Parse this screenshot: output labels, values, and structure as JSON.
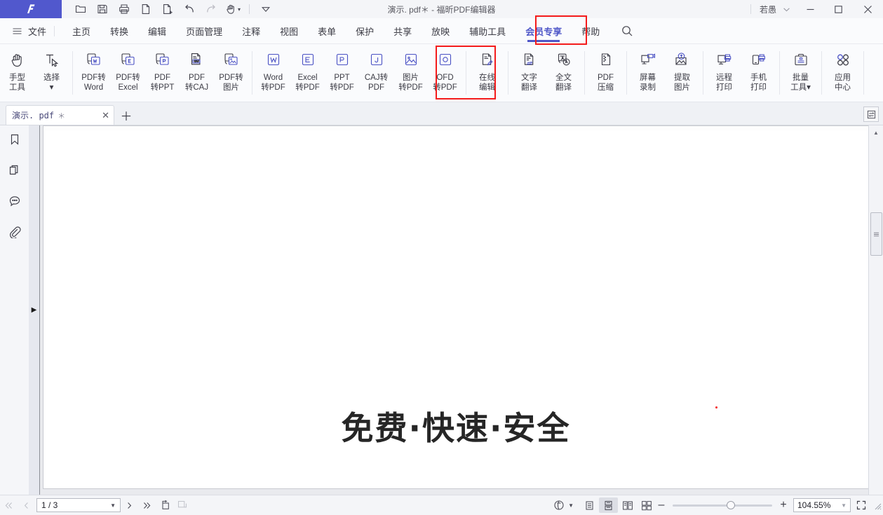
{
  "app": {
    "brand_color": "#5158cd",
    "logo_letter": "F",
    "window_title": "演示. pdf＊ - 福昕PDF编辑器",
    "file_name": "演示. pdf",
    "modified_mark": "＊",
    "title_suffix": "- 福昕PDF编辑器",
    "user_name": "若愚"
  },
  "quick_access": [
    {
      "name": "open-file",
      "icon": "folder-icon"
    },
    {
      "name": "save",
      "icon": "save-icon"
    },
    {
      "name": "print",
      "icon": "printer-icon"
    },
    {
      "name": "new-from-file",
      "icon": "document-icon"
    },
    {
      "name": "new-page",
      "icon": "document-add-icon"
    },
    {
      "name": "undo",
      "icon": "undo-icon"
    },
    {
      "name": "redo",
      "icon": "redo-icon"
    },
    {
      "name": "hand-tool",
      "icon": "hand-icon"
    },
    {
      "name": "customize",
      "icon": "chevron-down-icon"
    }
  ],
  "window_controls": {
    "minimize": "—",
    "maximize": "☐",
    "close": "✕"
  },
  "menubar": {
    "file_label": "文件",
    "items": [
      {
        "label": "主页",
        "active": false
      },
      {
        "label": "转换",
        "active": false
      },
      {
        "label": "编辑",
        "active": false
      },
      {
        "label": "页面管理",
        "active": false
      },
      {
        "label": "注释",
        "active": false
      },
      {
        "label": "视图",
        "active": false
      },
      {
        "label": "表单",
        "active": false
      },
      {
        "label": "保护",
        "active": false
      },
      {
        "label": "共享",
        "active": false
      },
      {
        "label": "放映",
        "active": false
      },
      {
        "label": "辅助工具",
        "active": false
      },
      {
        "label": "会员专享",
        "active": true
      },
      {
        "label": "帮助",
        "active": false
      }
    ],
    "highlight_color": "#f41b1b",
    "active_color": "#4f57c8"
  },
  "ribbon": {
    "groups": [
      {
        "name": "tools",
        "items": [
          {
            "name": "hand-tool",
            "icon": "hand-icon",
            "line1": "手型",
            "line2": "工具",
            "caret": false
          },
          {
            "name": "select-tool",
            "icon": "select-text-icon",
            "line1": "选择",
            "line2": "▾",
            "caret": true
          }
        ]
      },
      {
        "name": "pdf-to-x",
        "items": [
          {
            "name": "pdf-to-word",
            "icon": "pdf-to-word-icon",
            "line1": "PDF转",
            "line2": "Word"
          },
          {
            "name": "pdf-to-excel",
            "icon": "pdf-to-excel-icon",
            "line1": "PDF转",
            "line2": "Excel"
          },
          {
            "name": "pdf-to-ppt",
            "icon": "pdf-to-ppt-icon",
            "line1": "PDF",
            "line2": "转PPT"
          },
          {
            "name": "pdf-to-caj",
            "icon": "pdf-to-caj-icon",
            "line1": "PDF",
            "line2": "转CAJ"
          },
          {
            "name": "pdf-to-image",
            "icon": "pdf-to-image-icon",
            "line1": "PDF转",
            "line2": "图片"
          }
        ]
      },
      {
        "name": "x-to-pdf",
        "items": [
          {
            "name": "word-to-pdf",
            "icon": "word-icon",
            "line1": "Word",
            "line2": "转PDF"
          },
          {
            "name": "excel-to-pdf",
            "icon": "excel-icon",
            "line1": "Excel",
            "line2": "转PDF"
          },
          {
            "name": "ppt-to-pdf",
            "icon": "ppt-icon",
            "line1": "PPT",
            "line2": "转PDF"
          },
          {
            "name": "caj-to-pdf",
            "icon": "caj-icon",
            "line1": "CAJ转",
            "line2": "PDF"
          },
          {
            "name": "image-to-pdf",
            "icon": "image-icon",
            "line1": "图片",
            "line2": "转PDF"
          },
          {
            "name": "ofd-to-pdf",
            "icon": "ofd-icon",
            "line1": "OFD",
            "line2": "转PDF"
          }
        ]
      },
      {
        "name": "online-edit",
        "items": [
          {
            "name": "online-edit",
            "icon": "online-edit-icon",
            "line1": "在线",
            "line2": "编辑"
          }
        ]
      },
      {
        "name": "translate",
        "highlighted": true,
        "items": [
          {
            "name": "text-translate",
            "icon": "text-translate-icon",
            "line1": "文字",
            "line2": "翻译"
          },
          {
            "name": "full-translate",
            "icon": "full-translate-icon",
            "line1": "全文",
            "line2": "翻译"
          }
        ]
      },
      {
        "name": "compress",
        "items": [
          {
            "name": "pdf-compress",
            "icon": "compress-icon",
            "line1": "PDF",
            "line2": "压缩"
          }
        ]
      },
      {
        "name": "capture",
        "items": [
          {
            "name": "screen-record",
            "icon": "screen-record-icon",
            "line1": "屏幕",
            "line2": "录制"
          },
          {
            "name": "extract-image",
            "icon": "extract-image-icon",
            "line1": "提取",
            "line2": "图片"
          }
        ]
      },
      {
        "name": "print-group",
        "items": [
          {
            "name": "remote-print",
            "icon": "remote-print-icon",
            "line1": "远程",
            "line2": "打印"
          },
          {
            "name": "mobile-print",
            "icon": "mobile-print-icon",
            "line1": "手机",
            "line2": "打印"
          }
        ]
      },
      {
        "name": "batch",
        "items": [
          {
            "name": "batch-tools",
            "icon": "briefcase-icon",
            "line1": "批量",
            "line2": "工具▾",
            "caret": true
          }
        ]
      },
      {
        "name": "app-center",
        "items": [
          {
            "name": "app-center",
            "icon": "grid-apps-icon",
            "line1": "应用",
            "line2": "中心"
          }
        ]
      }
    ],
    "highlight_color": "#f41b1b"
  },
  "doc_tabs": {
    "tabs": [
      {
        "name": "演示. pdf",
        "modified": "＊",
        "close": "✕",
        "active": true
      }
    ],
    "add_label": "＋"
  },
  "left_rail": [
    {
      "name": "bookmarks-panel",
      "icon": "bookmark-icon"
    },
    {
      "name": "thumbnails-panel",
      "icon": "pages-icon"
    },
    {
      "name": "comments-panel",
      "icon": "comment-icon"
    },
    {
      "name": "attachments-panel",
      "icon": "paperclip-icon"
    }
  ],
  "document": {
    "heading": "免费·快速·安全"
  },
  "status_bar": {
    "first_page": "«",
    "prev_page": "‹",
    "page_value": "1 / 3",
    "next_page": "›",
    "last_page": "»",
    "rotate_left": "rotate-left-icon",
    "rotate_right": "rotate-right-icon",
    "read_mode": "read-mode-icon",
    "view_modes": [
      {
        "name": "single-page-view",
        "icon": "single-page-icon",
        "active": false
      },
      {
        "name": "continuous-view",
        "icon": "continuous-page-icon",
        "active": true
      },
      {
        "name": "two-page-view",
        "icon": "two-page-icon",
        "active": false
      },
      {
        "name": "two-page-continuous-view",
        "icon": "two-page-continuous-icon",
        "active": false
      }
    ],
    "zoom_out": "–",
    "zoom_in": "+",
    "zoom_value": "104.55%",
    "fullscreen": "fullscreen-icon"
  }
}
